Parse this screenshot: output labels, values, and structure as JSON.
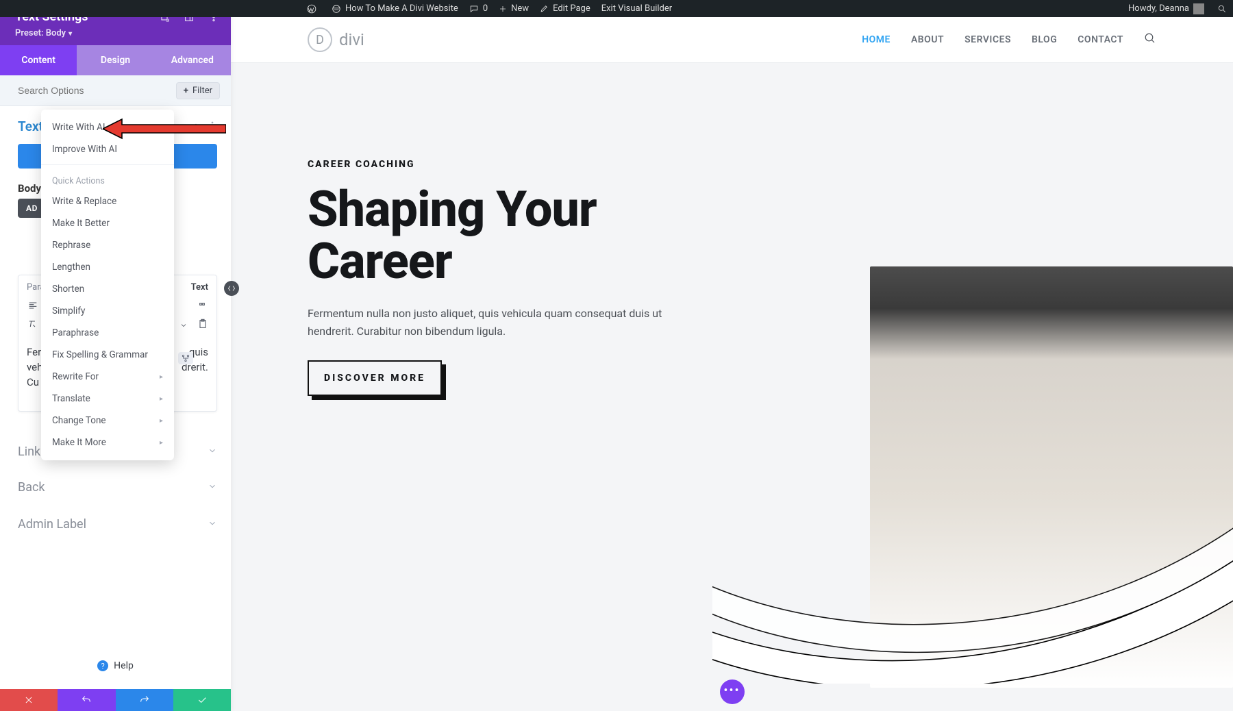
{
  "wpbar": {
    "site_title": "How To Make A Divi Website",
    "comments": "0",
    "new": "New",
    "edit_page": "Edit Page",
    "exit_vb": "Exit Visual Builder",
    "howdy": "Howdy, Deanna"
  },
  "panel": {
    "title": "Text Settings",
    "preset_label": "Preset: Body",
    "tabs": {
      "content": "Content",
      "design": "Design",
      "advanced": "Advanced"
    },
    "search_placeholder": "Search Options",
    "filter": "Filter",
    "section": "Text",
    "body_label": "Body",
    "add_button": "AD",
    "editor": {
      "left_tab": "Para",
      "right_tab": "Text",
      "sample_text": "Fer… quis vehi... drerit. Cur"
    },
    "sections": {
      "link": "Link",
      "background": "Back",
      "admin": "Admin Label"
    },
    "help": "Help"
  },
  "ai_menu": {
    "write": "Write With AI",
    "improve": "Improve With AI",
    "quick_actions": "Quick Actions",
    "items": [
      "Write & Replace",
      "Make It Better",
      "Rephrase",
      "Lengthen",
      "Shorten",
      "Simplify",
      "Paraphrase",
      "Fix Spelling & Grammar"
    ],
    "sub_items": [
      "Rewrite For",
      "Translate",
      "Change Tone",
      "Make It More"
    ]
  },
  "site": {
    "logo": "divi",
    "nav": {
      "home": "HOME",
      "about": "ABOUT",
      "services": "SERVICES",
      "blog": "BLOG",
      "contact": "CONTACT"
    },
    "eyebrow": "CAREER COACHING",
    "headline": "Shaping Your Career",
    "paragraph": "Fermentum nulla non justo aliquet, quis vehicula quam consequat duis ut hendrerit. Curabitur non bibendum ligula.",
    "cta": "DISCOVER MORE"
  },
  "colors": {
    "accent_purple": "#7e3ff2",
    "accent_blue": "#2b87ea"
  }
}
